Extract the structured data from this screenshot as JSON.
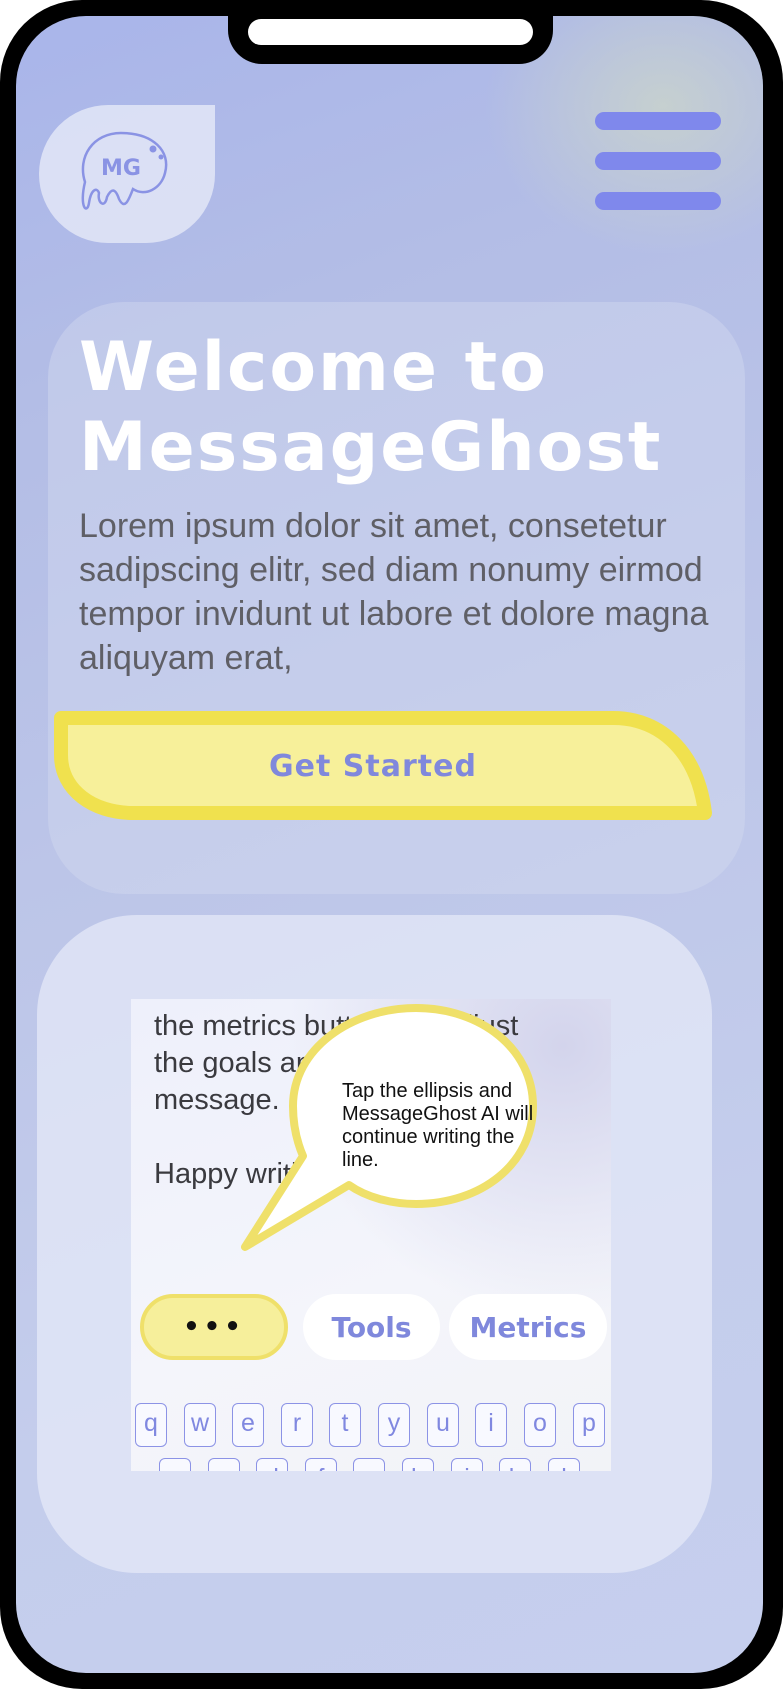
{
  "logo": {
    "text": "MG"
  },
  "menu": {
    "icon": "hamburger-icon",
    "color": "#7f88ec"
  },
  "hero": {
    "title": "Welcome to MessageGhost",
    "text": "Lorem ipsum dolor sit amet, consetetur sadipscing elitr, sed diam nonumy eirmod tempor invidunt ut labore et dolore magna aliquyam erat,",
    "cta_label": "Get Started"
  },
  "preview": {
    "message_lines": [
      "the metrics button. Or adjust",
      "the goals and tone of your",
      "message."
    ],
    "closing": "Happy writing!",
    "tooltip": "Tap the ellipsis and MessageGhost AI will continue writing the line.",
    "buttons": {
      "ellipsis": "•••",
      "tools": "Tools",
      "metrics": "Metrics"
    },
    "keyboard": {
      "row1": [
        "q",
        "w",
        "e",
        "r",
        "t",
        "y",
        "u",
        "i",
        "o",
        "p"
      ],
      "row2": [
        "a",
        "s",
        "d",
        "f",
        "g",
        "h",
        "j",
        "k",
        "l"
      ]
    }
  },
  "colors": {
    "accent": "#7f88ec",
    "cta_fill": "#f7f09a",
    "cta_border": "#f0e14e",
    "title": "#ffffff"
  }
}
